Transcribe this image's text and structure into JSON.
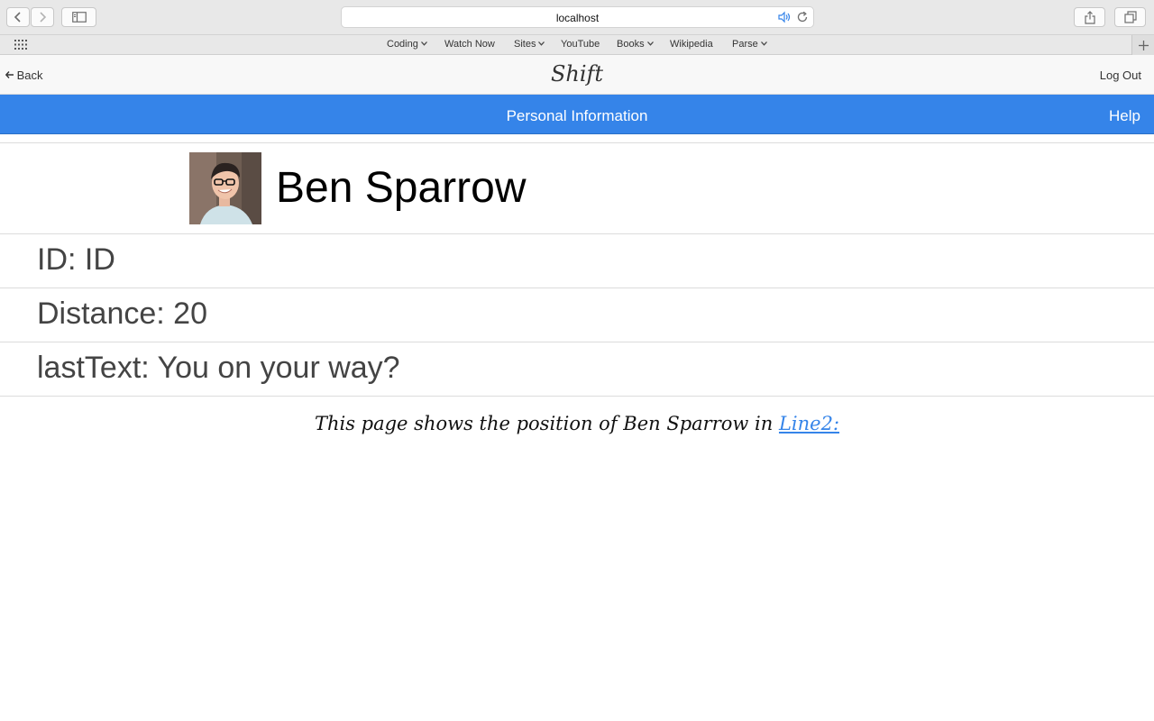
{
  "browser": {
    "url": "localhost",
    "bookmarks": [
      {
        "label": "Coding",
        "has_menu": true
      },
      {
        "label": "Watch Now",
        "has_menu": false
      },
      {
        "label": "Sites",
        "has_menu": true
      },
      {
        "label": "YouTube",
        "has_menu": false
      },
      {
        "label": "Books",
        "has_menu": true
      },
      {
        "label": "Wikipedia",
        "has_menu": false
      },
      {
        "label": "Parse",
        "has_menu": true
      }
    ]
  },
  "header": {
    "back_label": "Back",
    "brand": "Shift",
    "logout_label": "Log Out"
  },
  "nav_bar": {
    "title": "Personal Information",
    "help_label": "Help",
    "color": "#3584e9"
  },
  "profile": {
    "name": "Ben Sparrow"
  },
  "details": {
    "id_text": "ID: ID",
    "distance_text": "Distance: 20",
    "last_text": "lastText: You on your way?"
  },
  "footer": {
    "text": "This page shows the position of Ben Sparrow in ",
    "link_label": "Line2:"
  }
}
